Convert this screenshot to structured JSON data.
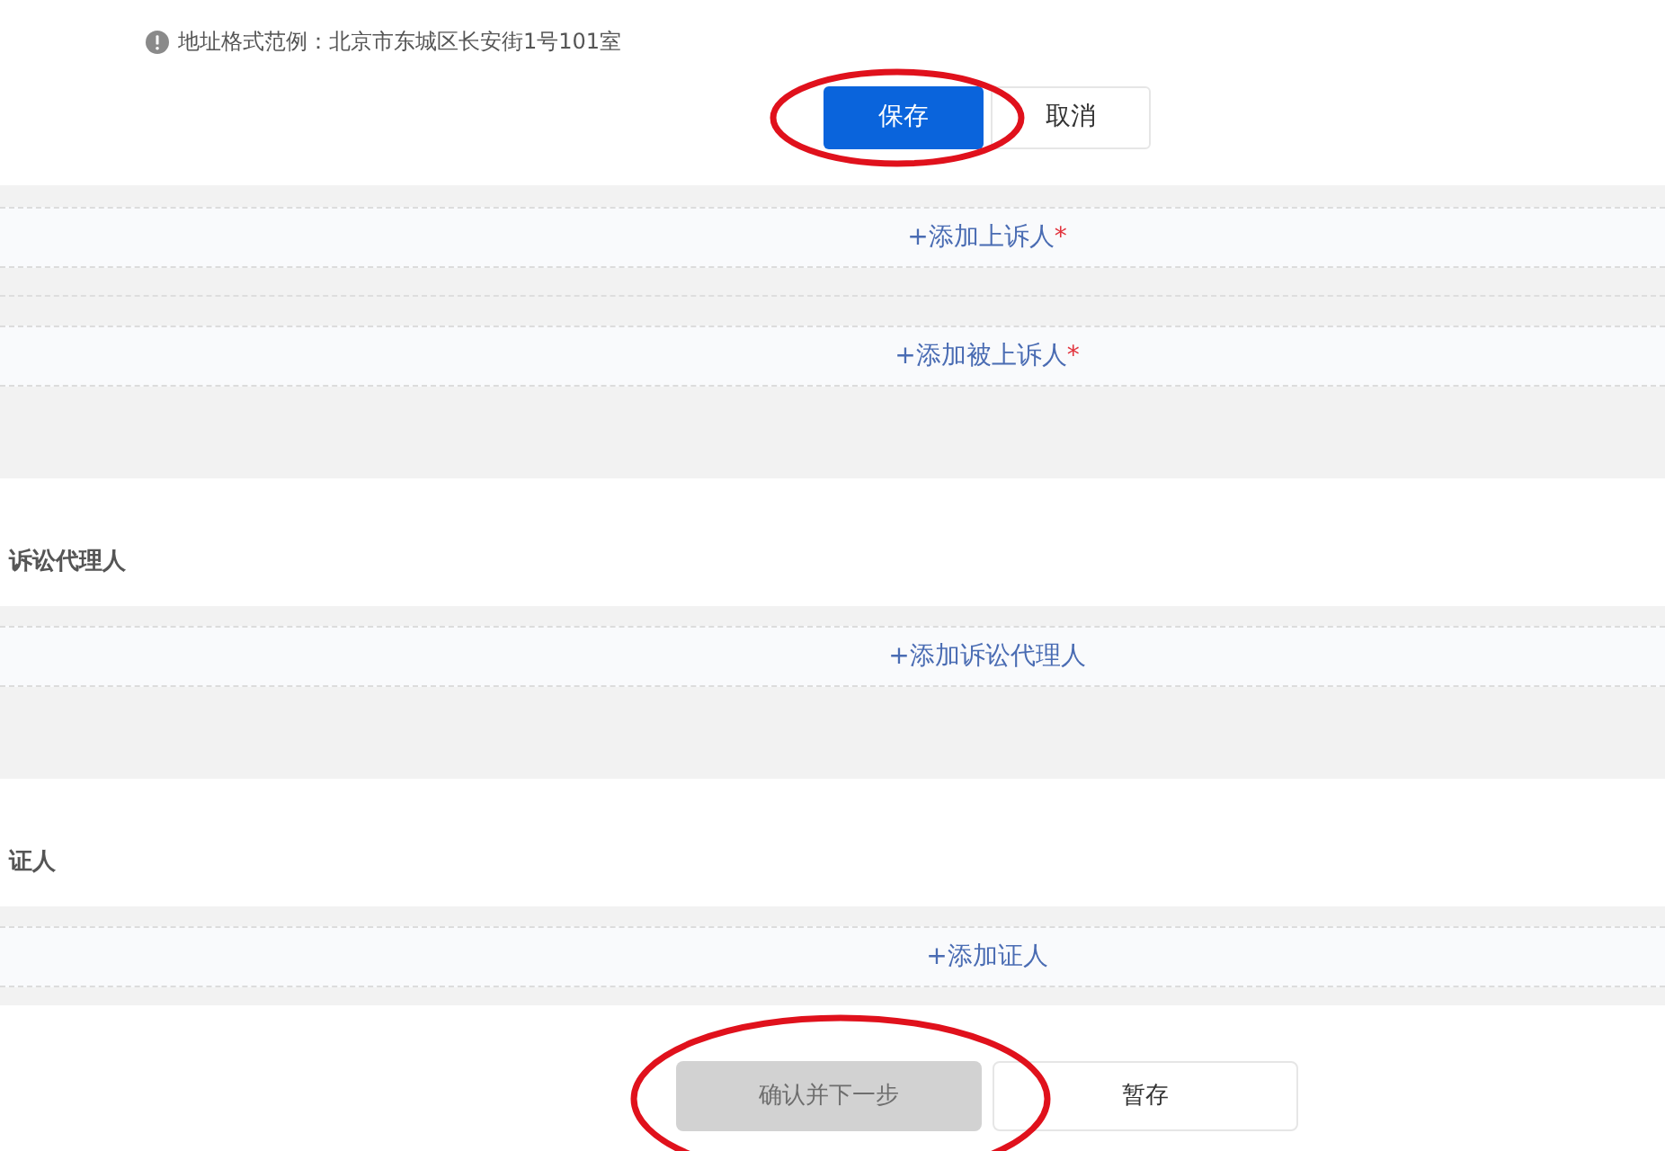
{
  "address_hint": {
    "text": "地址格式范例：北京市东城区长安街1号101室"
  },
  "form_actions": [
    {
      "label": "保存",
      "kind": "primary",
      "circled": true
    },
    {
      "label": "取消",
      "kind": "default",
      "circled": false
    }
  ],
  "sections": [
    {
      "add_rows": [
        {
          "label": "+添加上诉人",
          "required_mark": "*"
        },
        {
          "label": "+添加被上诉人",
          "required_mark": "*"
        }
      ]
    },
    {
      "title": "诉讼代理人",
      "add_rows": [
        {
          "label": "+添加诉讼代理人"
        }
      ]
    },
    {
      "title": "证人",
      "add_rows": [
        {
          "label": "+添加证人"
        }
      ]
    }
  ],
  "bottom_actions": [
    {
      "label": "确认并下一步",
      "kind": "primary",
      "disabled": true,
      "circled": true
    },
    {
      "label": "暂存",
      "kind": "default",
      "disabled": false,
      "circled": false
    }
  ]
}
